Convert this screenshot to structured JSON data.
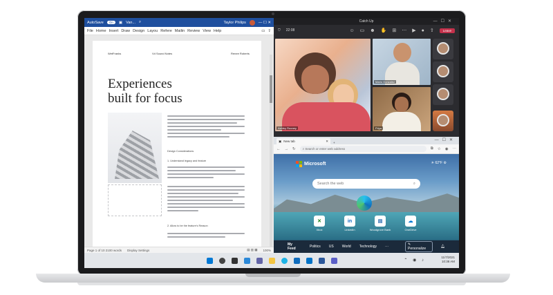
{
  "word": {
    "autosave": "AutoSave",
    "toggle": "On",
    "doc_name": "Van...",
    "user": "Taylor Philips",
    "menu": [
      "File",
      "Home",
      "Insert",
      "Draw",
      "Design",
      "Layout",
      "References",
      "Mailings",
      "Review",
      "View",
      "Help"
    ],
    "menu_short": [
      "File",
      "Home",
      "Insert",
      "Draw",
      "Design",
      "Layou",
      "Refere",
      "Mailin",
      "Review",
      "View",
      "Help"
    ],
    "page_header_left": "WetFranks",
    "page_header_mid": "Vd Sound Notes",
    "page_header_right": "Renee Roberts",
    "title_line1": "Experiences",
    "title_line2": "built for focus",
    "section1": "Design Considerations",
    "section1b": "1. Understand legacy and feature",
    "section2": "2. Allow to be the feature's Reason",
    "status_left": "Page 1 of 10  2100 words",
    "status_mid": "Display Settings",
    "zoom": "100%"
  },
  "teams": {
    "window_title": "Catch Up",
    "time": "22:08",
    "leave": "Leave",
    "participants": [
      "Ashley Rooney",
      "Mario Gonzalez",
      "Priya"
    ]
  },
  "edge": {
    "tab_title": "New tab",
    "address_placeholder": "Search or enter web address",
    "brand": "Microsoft",
    "weather": "62°F",
    "search_placeholder": "Search the web",
    "quick_links": [
      "Xbox",
      "LinkedIn",
      "Woodgrove Bank",
      "OneDrive"
    ],
    "feed": [
      "My Feed",
      "Politics",
      "US",
      "World",
      "Technology"
    ],
    "personalize": "Personalize",
    "more": "···"
  },
  "taskbar": {
    "time": "10:38 AM",
    "date": "11/7/2021"
  },
  "colors": {
    "word_blue": "#1f4f9e",
    "leave_red": "#c4314b",
    "edge_dark": "#1b2a3b"
  }
}
